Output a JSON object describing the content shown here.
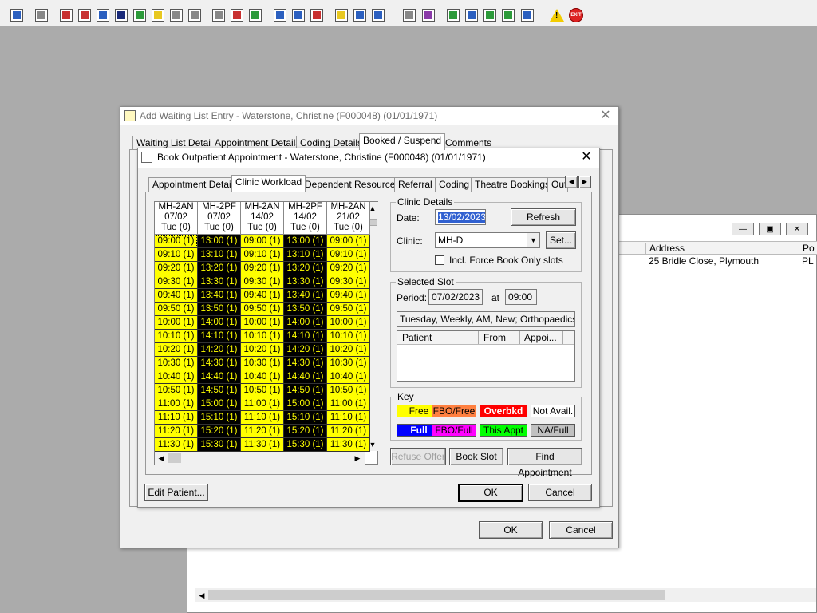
{
  "toolbar": {
    "icons": [
      "patient-search-icon",
      "printer-icon",
      "book-icon",
      "open-book-icon",
      "chart-icon",
      "mail-icon",
      "person-icon",
      "notepad-icon",
      "card-icon",
      "card2-icon",
      "glasses-icon",
      "clock-icon",
      "monitor-icon",
      "calendar-icon",
      "form-icon",
      "dial-icon",
      "list-icon",
      "bed-icon",
      "ambulance-icon",
      "document-icon",
      "bar-chart-icon",
      "globe-icon",
      "inbox-icon",
      "download-icon",
      "transfer-icon",
      "swap-icon",
      "warning-icon",
      "exit-icon"
    ],
    "exit_label": "EXIT",
    "warning_label": "!"
  },
  "background_window": {
    "columns": [
      "Address",
      "Po"
    ],
    "row": {
      "address": "25 Bridle Close, Plymouth",
      "postcode": "PL"
    }
  },
  "outer_dialog": {
    "title": "Add Waiting List Entry - Waterstone, Christine (F000048) (01/01/1971)",
    "tabs": [
      "Waiting List Details",
      "Appointment Details",
      "Coding Details",
      "Booked / Suspend",
      "Comments"
    ],
    "ok_label": "OK",
    "cancel_label": "Cancel"
  },
  "inner_dialog": {
    "title": "Book Outpatient Appointment - Waterstone, Christine (F000048) (01/01/1971)",
    "tabs": [
      "Appointment Details",
      "Clinic Workload",
      "Dependent Resources",
      "Referral",
      "Coding",
      "Theatre Bookings",
      "Out"
    ],
    "schedule": {
      "columns": [
        {
          "code": "MH-2AN",
          "date": "07/02",
          "day": "Tue  (0)"
        },
        {
          "code": "MH-2PF",
          "date": "07/02",
          "day": "Tue  (0)"
        },
        {
          "code": "MH-2AN",
          "date": "14/02",
          "day": "Tue  (0)"
        },
        {
          "code": "MH-2PF",
          "date": "14/02",
          "day": "Tue  (0)"
        },
        {
          "code": "MH-2AN",
          "date": "21/02",
          "day": "Tue  (0)"
        }
      ],
      "am_times": [
        "09:00 (1)",
        "09:10 (1)",
        "09:20 (1)",
        "09:30 (1)",
        "09:40 (1)",
        "09:50 (1)",
        "10:00 (1)",
        "10:10 (1)",
        "10:20 (1)",
        "10:30 (1)",
        "10:40 (1)",
        "10:50 (1)",
        "11:00 (1)",
        "11:10 (1)",
        "11:20 (1)",
        "11:30 (1)"
      ],
      "pm_times": [
        "13:00 (1)",
        "13:10 (1)",
        "13:20 (1)",
        "13:30 (1)",
        "13:40 (1)",
        "13:50 (1)",
        "14:00 (1)",
        "14:10 (1)",
        "14:20 (1)",
        "14:30 (1)",
        "14:40 (1)",
        "14:50 (1)",
        "15:00 (1)",
        "15:10 (1)",
        "15:20 (1)",
        "15:30 (1)"
      ]
    },
    "clinic_details": {
      "group_label": "Clinic Details",
      "date_label": "Date:",
      "date_value": "13/02/2023",
      "refresh_label": "Refresh",
      "clinic_label": "Clinic:",
      "clinic_value": "MH-D",
      "set_label": "Set...",
      "force_book_label": "Incl. Force Book Only slots"
    },
    "selected_slot": {
      "group_label": "Selected Slot",
      "period_label": "Period:",
      "period_value": "07/02/2023",
      "at_label": "at",
      "time_value": "09:00",
      "description": "Tuesday, Weekly, AM, New; Orthopaedics, Or",
      "table_columns": [
        "Patient",
        "From",
        "Appoi..."
      ]
    },
    "key": {
      "group_label": "Key",
      "items": [
        {
          "label": "Free",
          "bg": "#ffff00",
          "fg": "#000000"
        },
        {
          "label": "FBO/Free",
          "bg": "#ff8040",
          "fg": "#000000"
        },
        {
          "label": "Overbkd",
          "bg": "#ff0000",
          "fg": "#ffffff"
        },
        {
          "label": "Not Avail.",
          "bg": "#ffffff",
          "fg": "#000000"
        },
        {
          "label": "Full",
          "bg": "#0000ff",
          "fg": "#ffffff"
        },
        {
          "label": "FBO/Full",
          "bg": "#ff00ff",
          "fg": "#000000"
        },
        {
          "label": "This Appt",
          "bg": "#00ff00",
          "fg": "#000000"
        },
        {
          "label": "NA/Full",
          "bg": "#c0c0c0",
          "fg": "#000000"
        }
      ]
    },
    "refuse_offer_label": "Refuse Offer",
    "book_slot_label": "Book Slot",
    "find_appointment_label": "Find Appointment",
    "edit_patient_label": "Edit Patient...",
    "ok_label": "OK",
    "cancel_label": "Cancel"
  }
}
